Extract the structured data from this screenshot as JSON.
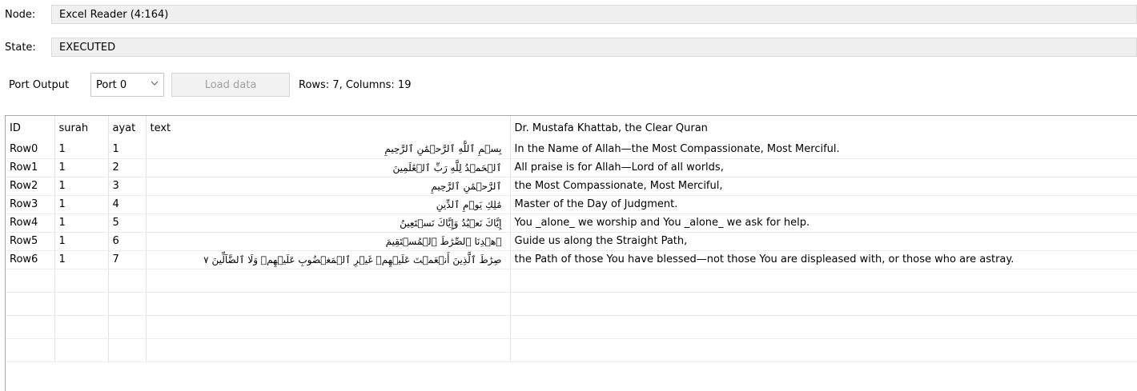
{
  "node": {
    "label": "Node:",
    "value": "Excel Reader  (4:164)"
  },
  "state": {
    "label": "State:",
    "value": "EXECUTED"
  },
  "toolbar": {
    "port_output_label": "Port Output",
    "port_select_value": "Port 0",
    "load_button_label": "Load data",
    "rows_info": "Rows: 7, Columns: 19"
  },
  "table": {
    "columns": [
      "ID",
      "surah",
      "ayat",
      "text",
      "Dr. Mustafa Khattab, the Clear Quran"
    ],
    "rows": [
      [
        "Row0",
        "1",
        "1",
        "بِسۡمِ ٱللَّهِ ٱلرَّحۡمَٰنِ ٱلرَّحِيمِ",
        "In the Name of Allah—the Most Compassionate, Most Merciful."
      ],
      [
        "Row1",
        "1",
        "2",
        "ٱلۡحَمۡدُ لِلَّهِ رَبِّ ٱلۡعَٰلَمِينَ",
        "All praise is for Allah—Lord of all worlds,"
      ],
      [
        "Row2",
        "1",
        "3",
        "ٱلرَّحۡمَٰنِ ٱلرَّحِيمِ",
        "the Most Compassionate, Most Merciful,"
      ],
      [
        "Row3",
        "1",
        "4",
        "مَٰلِكِ يَوۡمِ ٱلدِّينِ",
        "Master of the Day of Judgment."
      ],
      [
        "Row4",
        "1",
        "5",
        "إِيَّاكَ نَعۡبُدُ وَإِيَّاكَ نَسۡتَعِينُ",
        "You _alone_ we worship and You _alone_ we ask for help."
      ],
      [
        "Row5",
        "1",
        "6",
        "ٱهۡدِنَا ٱلصِّرَٰطَ ٱلۡمُسۡتَقِيمَ",
        "Guide us along the Straight Path,"
      ],
      [
        "Row6",
        "1",
        "7",
        "صِرَٰطَ ٱلَّذِينَ أَنۡعَمۡتَ عَلَيۡهِمۡ غَيۡرِ ٱلۡمَغۡضُوبِ عَلَيۡهِمۡ وَلَا ٱلضَّآلِّينَ ٧",
        "the Path of those You have blessed—not those You are displeased with, or those who are astray."
      ]
    ]
  },
  "icons": {
    "port_dropdown": "chevron-down-icon"
  }
}
